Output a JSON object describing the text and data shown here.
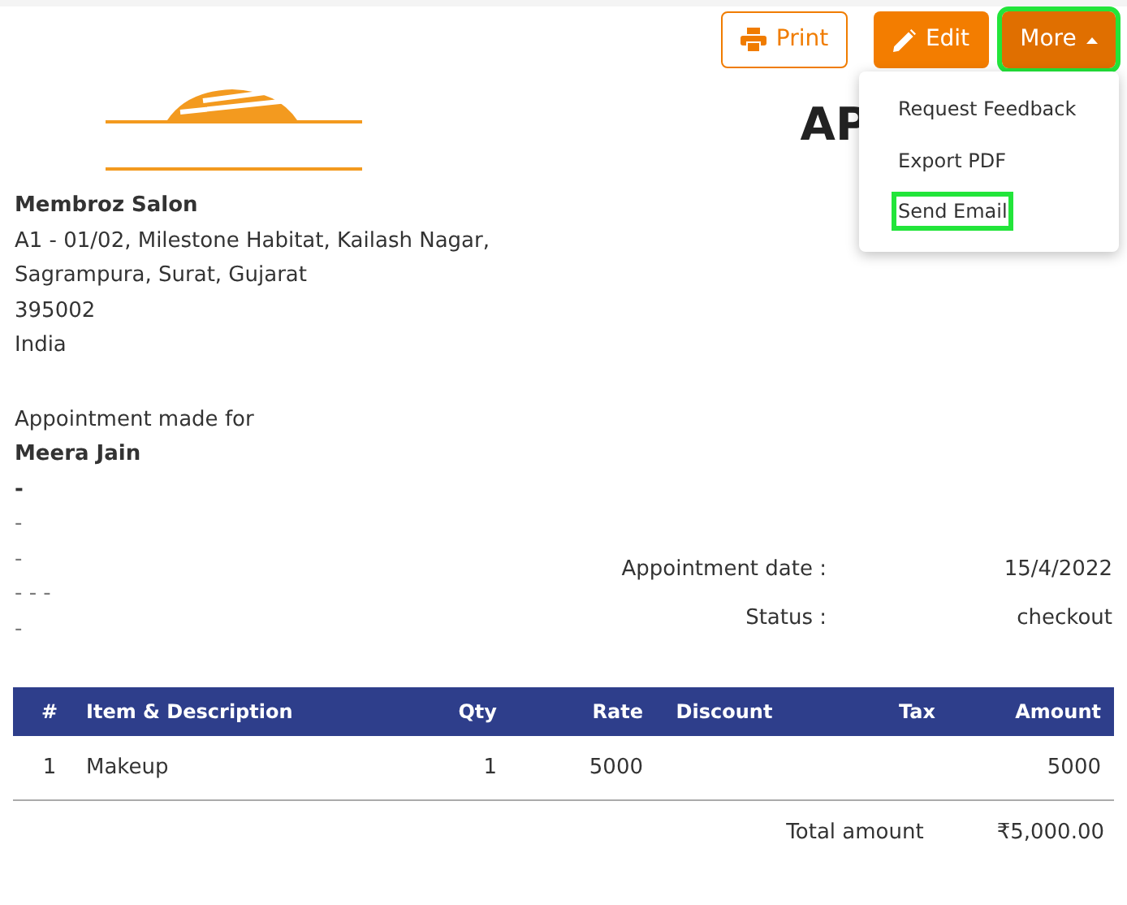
{
  "toolbar": {
    "buttons": [
      {
        "kind": "print",
        "label": "Print",
        "highlighted": false
      },
      {
        "kind": "edit",
        "label": "Edit",
        "highlighted": false
      },
      {
        "kind": "more",
        "label": "More",
        "highlighted": true
      }
    ]
  },
  "menu": {
    "items": [
      {
        "label": "Request Feedback",
        "highlighted": false
      },
      {
        "label": "Export PDF",
        "highlighted": false
      },
      {
        "label": "Send Email",
        "highlighted": true
      }
    ]
  },
  "title": "AP",
  "company": {
    "name": "Membroz Salon",
    "address": [
      "A1 - 01/02, Milestone Habitat, Kailash Nagar,",
      "Sagrampura, Surat, Gujarat",
      "395002",
      "India"
    ]
  },
  "customer": {
    "caption": "Appointment made for",
    "name": "Meera Jain",
    "lines": [
      "-",
      "-",
      "-",
      "- - -",
      "-"
    ]
  },
  "details": [
    {
      "label": "Appointment date :",
      "value": "15/4/2022"
    },
    {
      "label": "Status :",
      "value": "checkout"
    }
  ],
  "table": {
    "columns": [
      "#",
      "Item & Description",
      "Qty",
      "Rate",
      "Discount",
      "Tax",
      "Amount"
    ],
    "rows": [
      [
        "1",
        "Makeup",
        "1",
        "5000",
        "",
        "",
        "5000"
      ]
    ]
  },
  "total": {
    "label": "Total amount",
    "value": "₹5,000.00"
  }
}
